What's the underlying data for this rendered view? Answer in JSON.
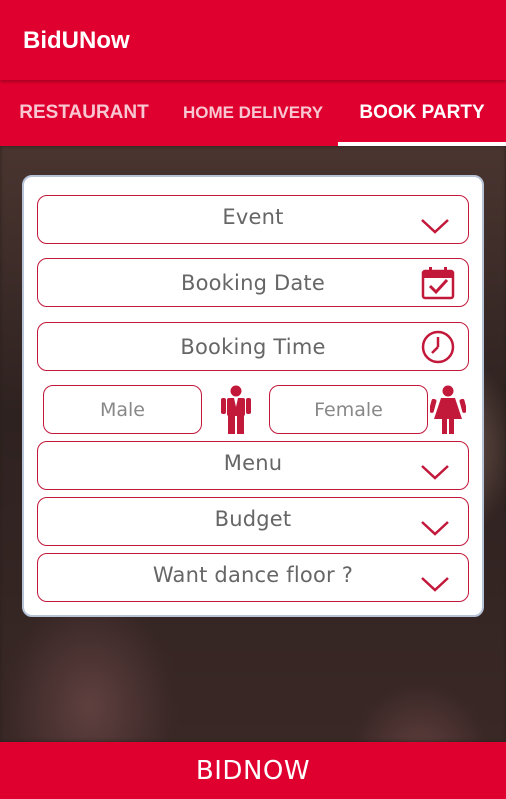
{
  "app": {
    "title": "BidUNow"
  },
  "tabs": [
    {
      "label": "RESTAURANT",
      "active": false
    },
    {
      "label": "HOME DELIVERY",
      "active": false
    },
    {
      "label": "BOOK PARTY",
      "active": true
    }
  ],
  "form": {
    "event": {
      "label": "Event",
      "icon": "chevron-down-icon"
    },
    "booking_date": {
      "placeholder": "Booking Date",
      "icon": "calendar-check-icon"
    },
    "booking_time": {
      "placeholder": "Booking Time",
      "icon": "clock-icon"
    },
    "male": {
      "placeholder": "Male",
      "icon": "male-person-icon"
    },
    "female": {
      "placeholder": "Female",
      "icon": "female-person-icon"
    },
    "menu": {
      "label": "Menu",
      "icon": "chevron-down-icon"
    },
    "budget": {
      "label": "Budget",
      "icon": "chevron-down-icon"
    },
    "dance_floor": {
      "label": "Want dance floor ?",
      "icon": "chevron-down-icon"
    }
  },
  "footer": {
    "button_label": "BIDNOW"
  },
  "colors": {
    "accent": "#e0002f",
    "field_border": "#c2183a",
    "card_border": "#b7c4d8"
  }
}
